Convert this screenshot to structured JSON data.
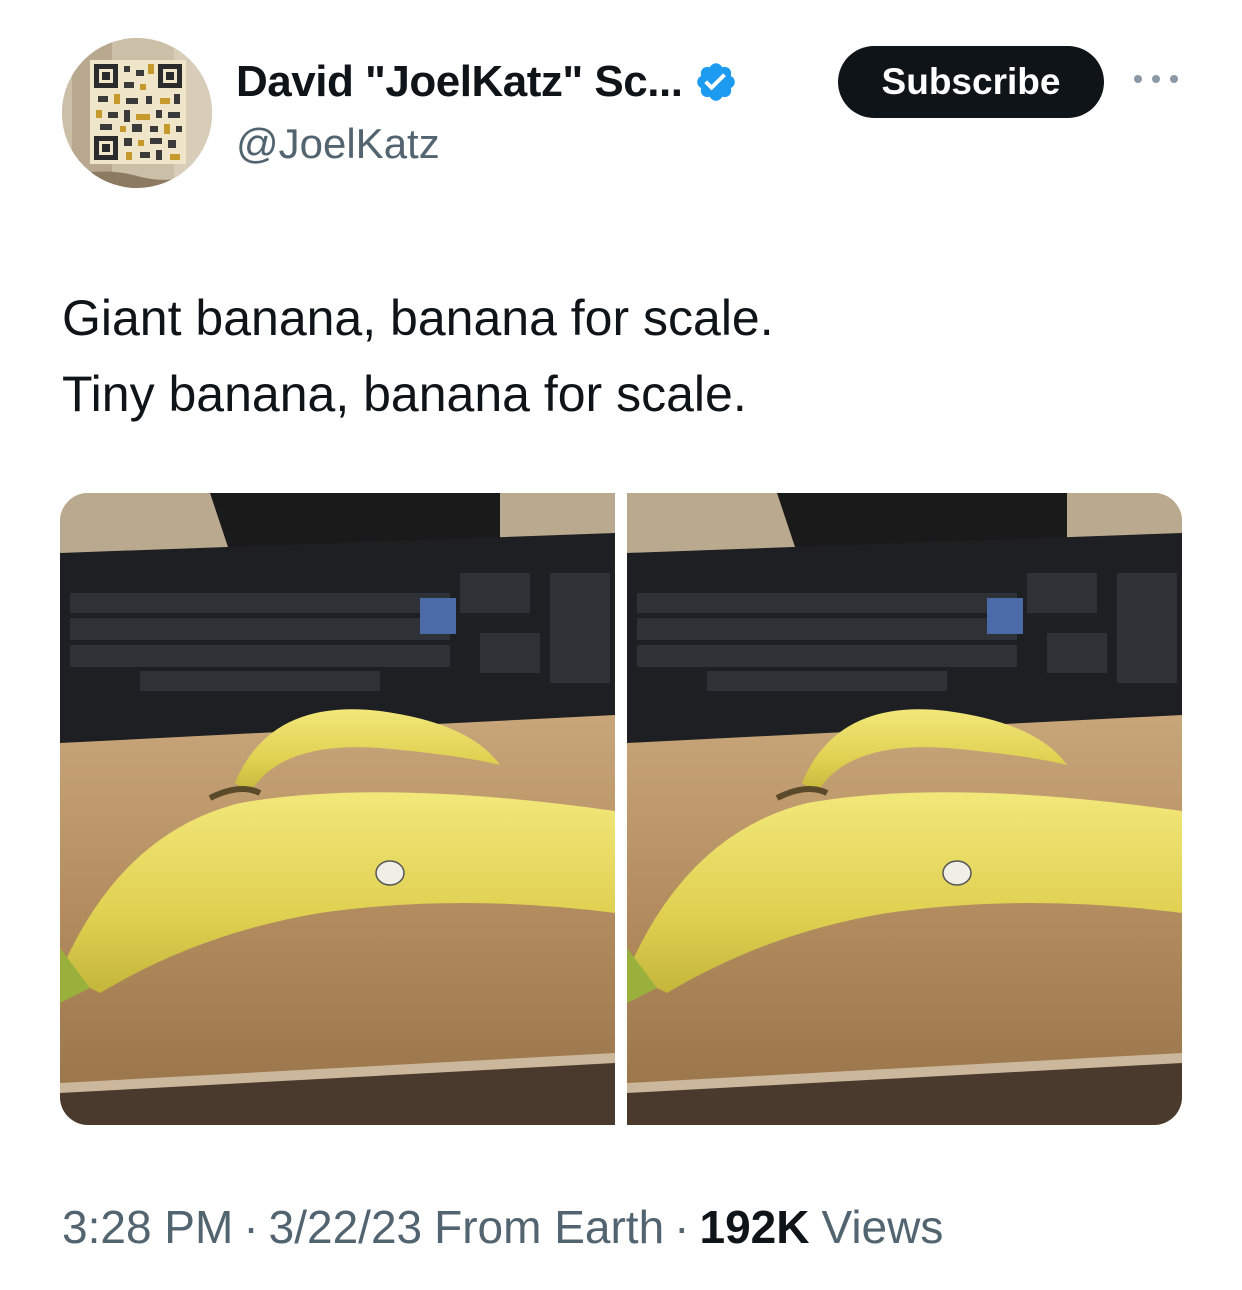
{
  "author": {
    "display_name": "David \"JoelKatz\" Sc...",
    "handle": "@JoelKatz",
    "verified": true
  },
  "actions": {
    "subscribe_label": "Subscribe"
  },
  "tweet": {
    "lines": [
      "Giant banana, banana for scale.",
      "Tiny banana, banana for scale."
    ]
  },
  "media": [
    {
      "alt": ""
    },
    {
      "alt": ""
    }
  ],
  "meta": {
    "time": "3:28 PM",
    "date": "3/22/23",
    "source": "From Earth",
    "views_count": "192K",
    "views_label": "Views",
    "separator": "·"
  },
  "colors": {
    "text_primary": "#0f1419",
    "text_secondary": "#536471",
    "verified_blue": "#1d9bf0",
    "button_bg": "#0f1419"
  },
  "icons": [
    "verified-badge-icon",
    "more-options-icon"
  ]
}
